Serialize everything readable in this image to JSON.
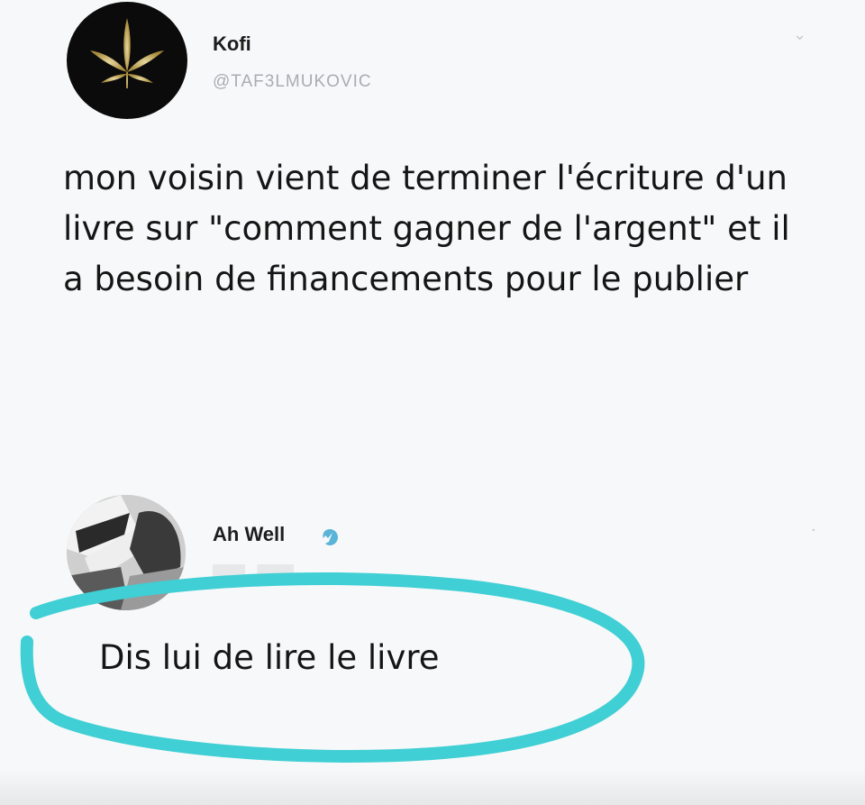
{
  "tweet": {
    "author_name": "Kofi",
    "author_handle": "@TAF3LMUKOVIC",
    "avatar_icon": "cannabis-leaf-icon",
    "text": "mon voisin vient de terminer l'écriture d'un\nlivre sur \"comment gagner de l'argent\" et il\na besoin de financements pour le  publier"
  },
  "reply": {
    "author_name": "Ah Well",
    "verified_icon": "verified-badge-icon",
    "text": "Dis lui de lire le livre"
  },
  "colors": {
    "highlight": "#3fcfd4",
    "background": "#f7f8f9"
  }
}
